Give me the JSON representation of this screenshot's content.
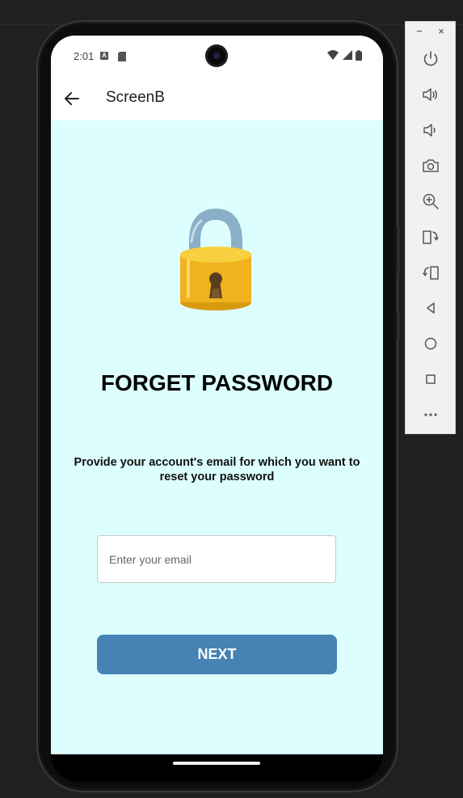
{
  "status_bar": {
    "time": "2:01",
    "icons": [
      "a-notification-icon",
      "sd-card-icon",
      "wifi-icon",
      "signal-icon",
      "battery-icon"
    ]
  },
  "app_bar": {
    "title": "ScreenB",
    "back_icon": "arrow-left-icon"
  },
  "content": {
    "illustration": "lock-icon",
    "heading": "FORGET PASSWORD",
    "description": "Provide your account's email for which you want to reset your password",
    "email_input": {
      "value": "",
      "placeholder": "Enter your email"
    },
    "next_button": "NEXT"
  },
  "emulator_toolbar": {
    "window_controls": {
      "minimize": "−",
      "close": "×"
    },
    "items": [
      "power-icon",
      "volume-up-icon",
      "volume-down-icon",
      "camera-icon",
      "zoom-in-icon",
      "rotate-left-icon",
      "rotate-right-icon",
      "back-icon",
      "home-icon",
      "overview-icon",
      "more-icon"
    ]
  },
  "colors": {
    "screen_background": "#dcfefe",
    "header_background": "#ffffff",
    "primary_button": "#4682b4",
    "lock_body": "#f0b21e",
    "lock_shackle": "#8ab0c8",
    "window_background": "#202020"
  }
}
